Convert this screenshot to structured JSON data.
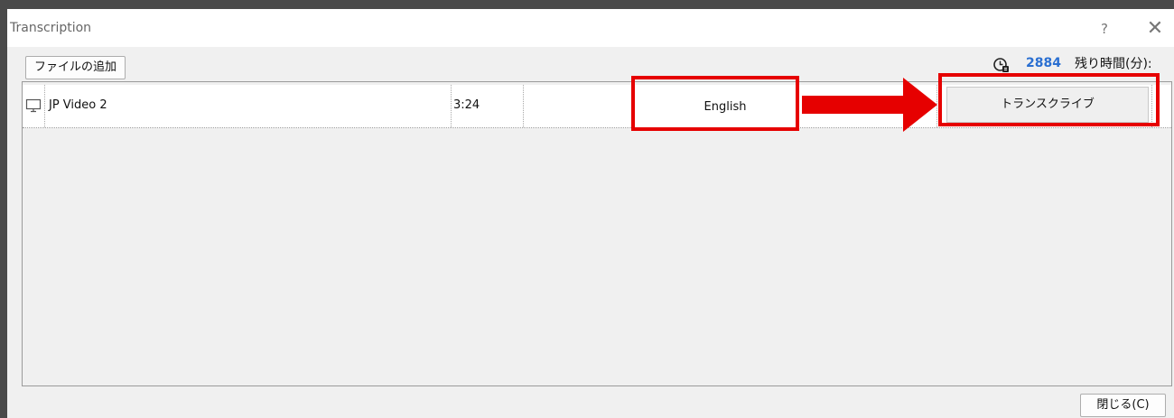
{
  "window": {
    "title": "Transcription",
    "help_glyph": "?",
    "close_glyph": "✕"
  },
  "toolbar": {
    "add_file_label": "ファイルの追加",
    "remaining_icon": "clock-icon",
    "remaining_value": "2884",
    "remaining_label": "残り時間(分):"
  },
  "files": [
    {
      "icon": "monitor-icon",
      "name": "JP Video 2",
      "duration": "3:24",
      "language": "English",
      "action_label": "トランスクライブ"
    }
  ],
  "footer": {
    "close_label": "閉じる(C)"
  },
  "colors": {
    "highlight": "#e60000",
    "remaining_value": "#2a6fd1"
  }
}
